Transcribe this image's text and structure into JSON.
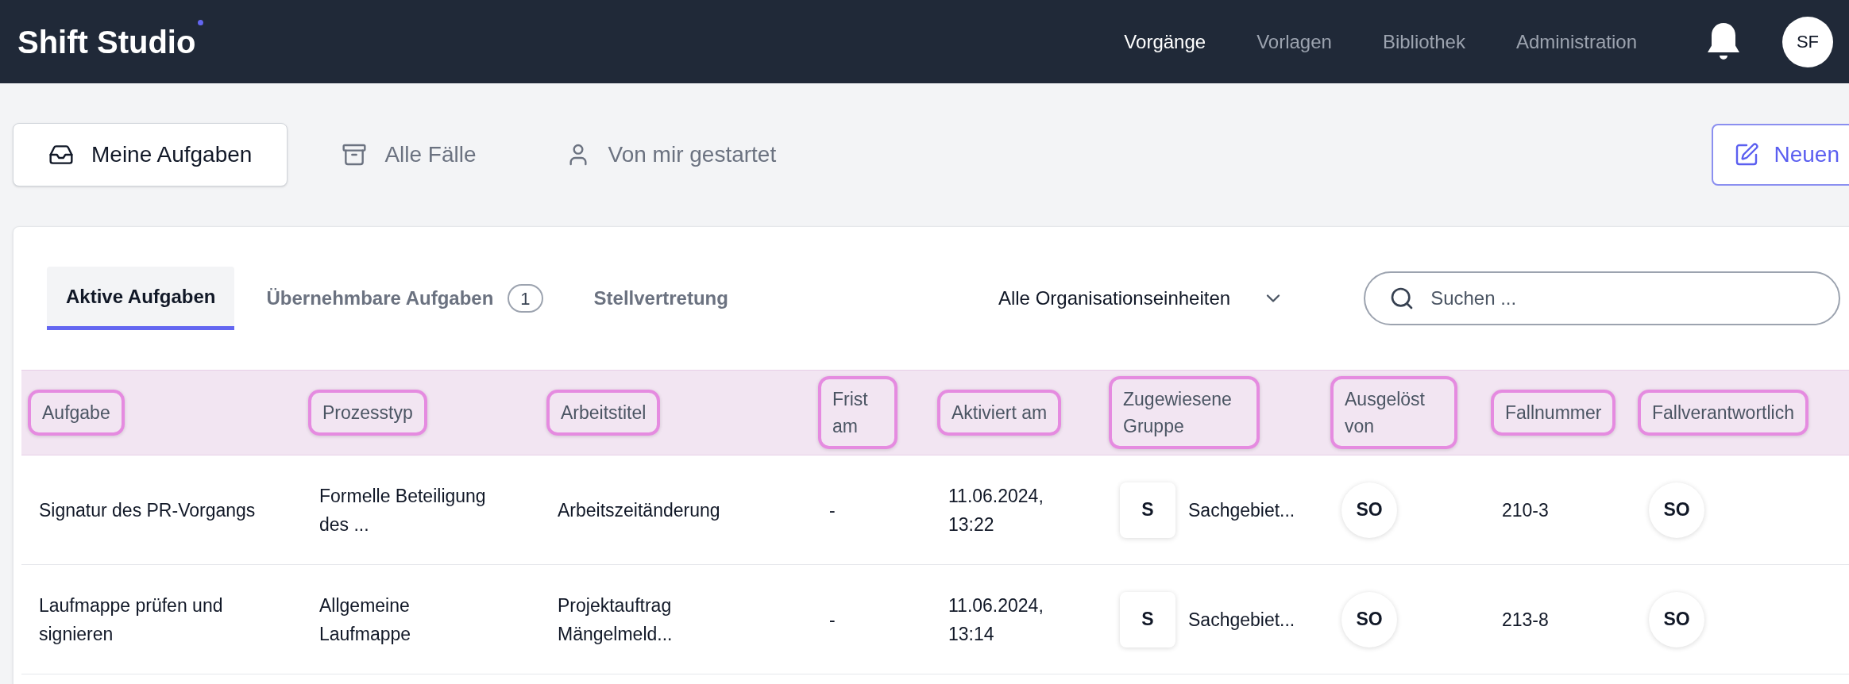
{
  "app": {
    "logo": "Shift Studio"
  },
  "nav": [
    {
      "label": "Vorgänge",
      "selected": true
    },
    {
      "label": "Vorlagen",
      "selected": false
    },
    {
      "label": "Bibliothek",
      "selected": false
    },
    {
      "label": "Administration",
      "selected": false
    }
  ],
  "user": {
    "initials": "SF"
  },
  "views": [
    {
      "label": "Meine Aufgaben",
      "selected": true
    },
    {
      "label": "Alle Fälle",
      "selected": false
    },
    {
      "label": "Von mir gestartet",
      "selected": false
    }
  ],
  "new_button": {
    "label": "Neuen"
  },
  "tabs": [
    {
      "label": "Aktive Aufgaben",
      "selected": true
    },
    {
      "label": "Übernehmbare Aufgaben",
      "selected": false,
      "badge": "1"
    },
    {
      "label": "Stellvertretung",
      "selected": false
    }
  ],
  "org_filter": {
    "value": "Alle Organisationseinheiten"
  },
  "search": {
    "placeholder": "Suchen ..."
  },
  "table": {
    "columns": [
      "Aufgabe",
      "Prozesstyp",
      "Arbeitstitel",
      "Frist am",
      "Aktiviert am",
      "Zugewiesene Gruppe",
      "Ausgelöst von",
      "Fallnummer",
      "Fallverantwortlich"
    ],
    "rows": [
      {
        "task": "Signatur des PR-Vorgangs",
        "process_type": "Formelle Beteiligung des ...",
        "work_title": "Arbeitszeitänderung",
        "deadline": "-",
        "activated": "11.06.2024, 13:22",
        "group": {
          "initial": "S",
          "name": "Sachgebiet..."
        },
        "triggered_by": "SO",
        "case_number": "210-3",
        "owner": "SO"
      },
      {
        "task": "Laufmappe prüfen und signieren",
        "process_type": "Allgemeine Laufmappe",
        "work_title": "Projektauftrag Mängelmeld...",
        "deadline": "-",
        "activated": "11.06.2024, 13:14",
        "group": {
          "initial": "S",
          "name": "Sachgebiet..."
        },
        "triggered_by": "SO",
        "case_number": "213-8",
        "owner": "SO"
      }
    ]
  }
}
